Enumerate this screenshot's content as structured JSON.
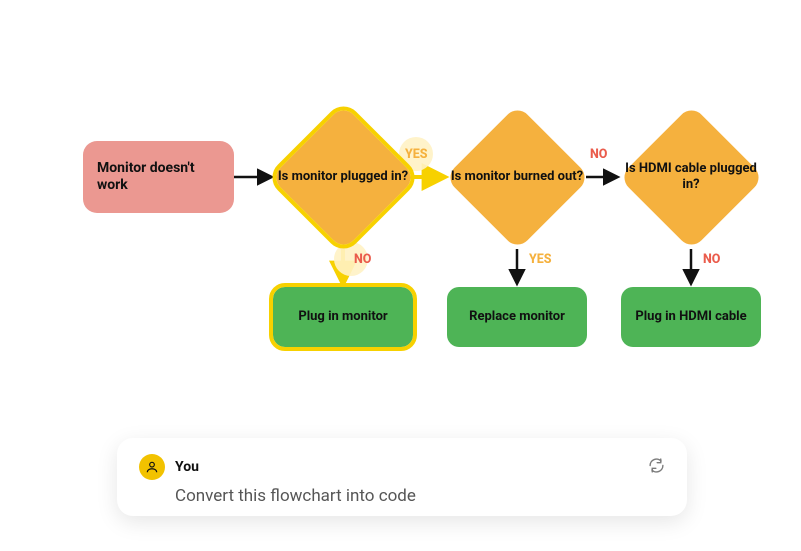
{
  "flow": {
    "start": "Monitor doesn't work",
    "d1": "Is monitor plugged in?",
    "d2": "Is monitor burned out?",
    "d3": "Is HDMI cable plugged in?",
    "a1": "Plug in monitor",
    "a2": "Replace monitor",
    "a3": "Plug in HDMI cable",
    "e_d1_yes": "YES",
    "e_d1_no": "NO",
    "e_d2_no": "NO",
    "e_d2_yes": "YES",
    "e_d3_no": "NO"
  },
  "chat": {
    "username": "You",
    "prompt": "Convert this flowchart into code"
  },
  "chart_data": {
    "type": "flowchart",
    "nodes": [
      {
        "id": "start",
        "kind": "terminator",
        "label": "Monitor doesn't work"
      },
      {
        "id": "d1",
        "kind": "decision",
        "label": "Is monitor plugged in?",
        "selected": true
      },
      {
        "id": "d2",
        "kind": "decision",
        "label": "Is monitor burned out?"
      },
      {
        "id": "d3",
        "kind": "decision",
        "label": "Is HDMI cable plugged in?"
      },
      {
        "id": "a1",
        "kind": "process",
        "label": "Plug in monitor",
        "selected": true
      },
      {
        "id": "a2",
        "kind": "process",
        "label": "Replace monitor"
      },
      {
        "id": "a3",
        "kind": "process",
        "label": "Plug in HDMI cable"
      }
    ],
    "edges": [
      {
        "from": "start",
        "to": "d1",
        "label": ""
      },
      {
        "from": "d1",
        "to": "d2",
        "label": "YES",
        "selected": true
      },
      {
        "from": "d1",
        "to": "a1",
        "label": "NO",
        "selected": true
      },
      {
        "from": "d2",
        "to": "d3",
        "label": "NO"
      },
      {
        "from": "d2",
        "to": "a2",
        "label": "YES"
      },
      {
        "from": "d3",
        "to": "a3",
        "label": "NO"
      }
    ]
  }
}
